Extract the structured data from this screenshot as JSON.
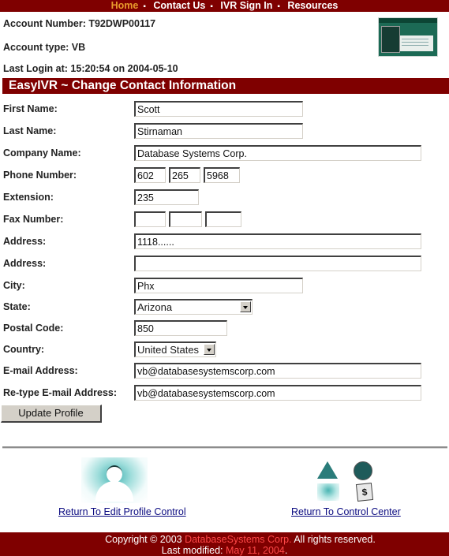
{
  "nav": {
    "items": [
      {
        "label": "Home",
        "active": true
      },
      {
        "label": "Contact Us",
        "active": false
      },
      {
        "label": "IVR Sign In",
        "active": false
      },
      {
        "label": "Resources",
        "active": false
      }
    ],
    "separator": "▪"
  },
  "account": {
    "number_text": "Account Number: T92DWP00117",
    "type_text": "Account type: VB",
    "last_login_text": "Last Login at: 15:20:54 on 2004-05-10",
    "license_image": "state-drivers-license-icon"
  },
  "section": {
    "title": "EasyIVR ~ Change Contact Information"
  },
  "form": {
    "first_name": {
      "label": "First Name:",
      "value": "Scott"
    },
    "last_name": {
      "label": "Last Name:",
      "value": "Stirnaman"
    },
    "company": {
      "label": "Company Name:",
      "value": "Database Systems Corp."
    },
    "phone": {
      "label": "Phone Number:",
      "area": "602",
      "prefix": "265",
      "line": "5968"
    },
    "extension": {
      "label": "Extension:",
      "value": "235"
    },
    "fax": {
      "label": "Fax Number:",
      "area": "",
      "prefix": "",
      "line": ""
    },
    "address1": {
      "label": "Address:",
      "value": "1118......"
    },
    "address2": {
      "label": "Address:",
      "value": ""
    },
    "city": {
      "label": "City:",
      "value": "Phx"
    },
    "state": {
      "label": "State:",
      "selected": "Arizona"
    },
    "postal": {
      "label": "Postal Code:",
      "value": "850"
    },
    "country": {
      "label": "Country:",
      "selected": "United States"
    },
    "email": {
      "label": "E-mail Address:",
      "value": "vb@databasesystemscorp.com"
    },
    "email_confirm": {
      "label": "Re-type E-mail Address:",
      "value": "vb@databasesystemscorp.com"
    },
    "submit_label": "Update Profile"
  },
  "links": {
    "edit_profile": "Return To Edit Profile Control",
    "control_center": "Return To Control Center"
  },
  "footer": {
    "copyright_prefix": "Copyright © 2003 ",
    "company": "DatabaseSystems Corp.",
    "copyright_suffix": " All rights reserved.",
    "modified_prefix": "Last modified: ",
    "modified_date": "May 11, 2004",
    "modified_suffix": "."
  },
  "colors": {
    "brand_bar": "#7f0000",
    "nav_active": "#e89a2c",
    "footer_highlight": "#ff4848",
    "link": "#0a0a80"
  }
}
